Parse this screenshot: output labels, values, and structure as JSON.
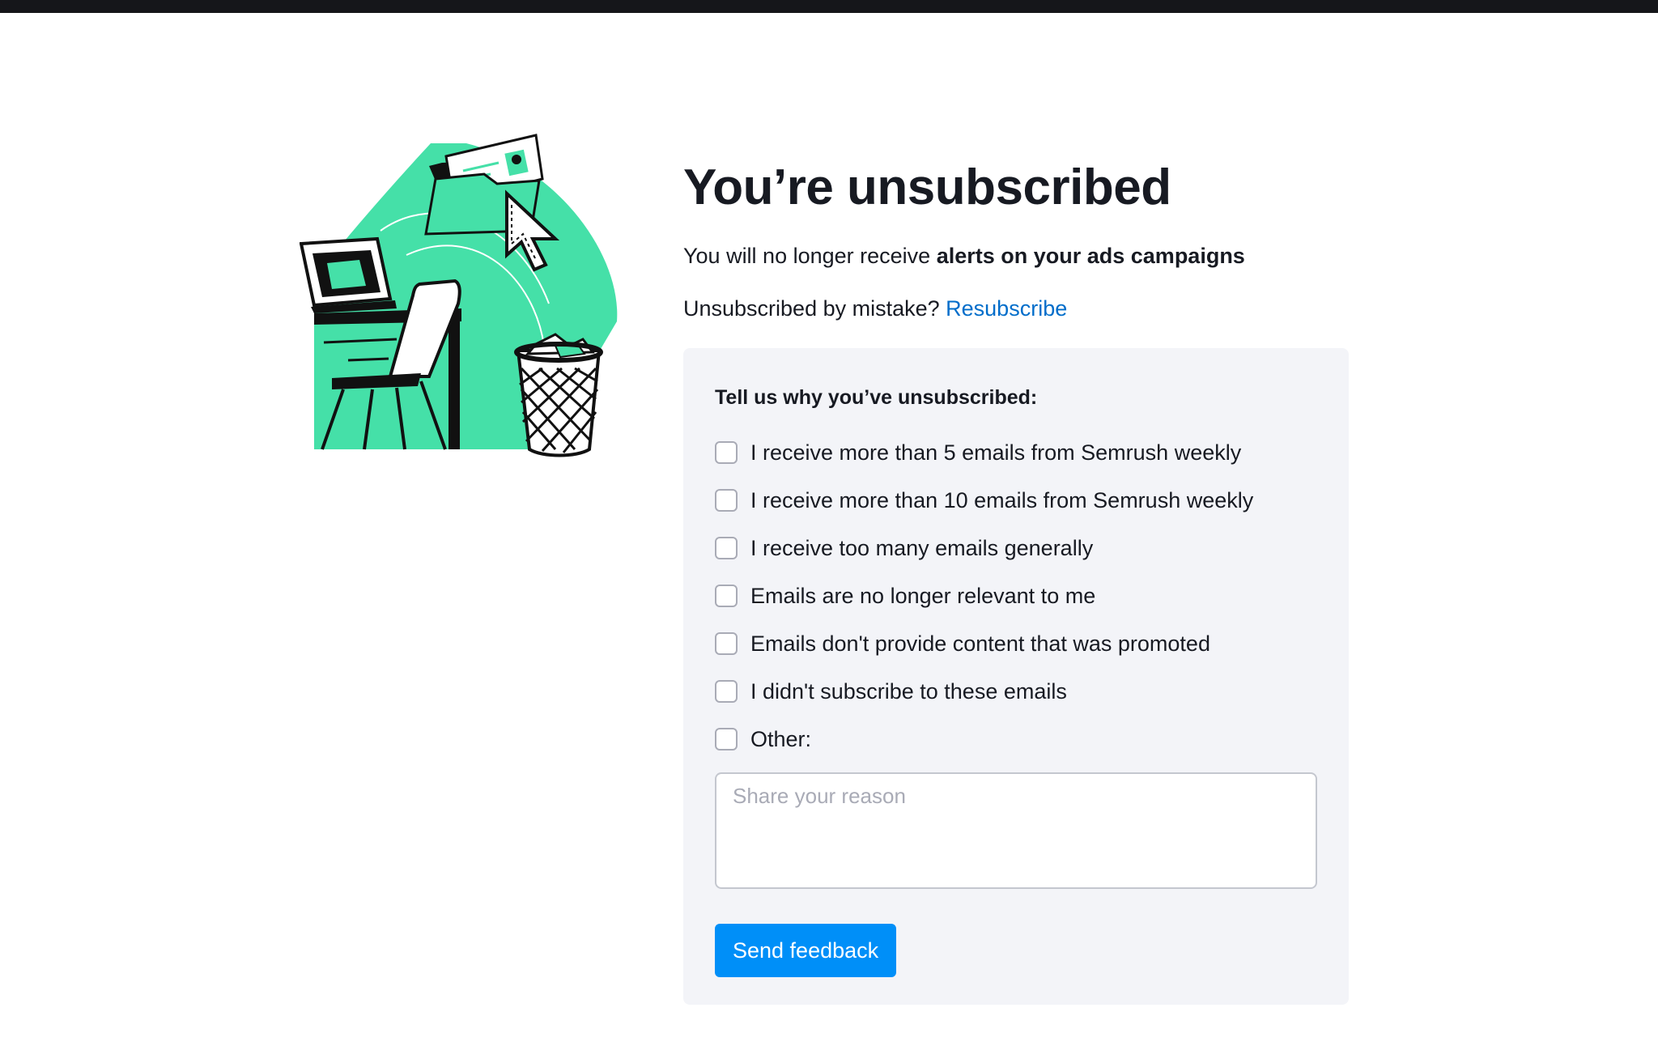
{
  "page": {
    "title": "You’re unsubscribed",
    "subtitle_prefix": "You will no longer receive ",
    "subtitle_bold": "alerts on your ads campaigns",
    "mistake_text": "Unsubscribed by mistake? ",
    "resubscribe_label": "Resubscribe"
  },
  "illustration": {
    "icon": "unsubscribe-illustration",
    "colors": {
      "accent": "#45e0a8",
      "outline": "#000000"
    }
  },
  "feedback": {
    "heading": "Tell us why you’ve unsubscribed:",
    "options": [
      {
        "label": "I receive more than 5 emails from Semrush weekly",
        "checked": false
      },
      {
        "label": "I receive more than 10 emails from Semrush weekly",
        "checked": false
      },
      {
        "label": "I receive too many emails generally",
        "checked": false
      },
      {
        "label": "Emails are no longer relevant to me",
        "checked": false
      },
      {
        "label": "Emails don't provide content that was promoted",
        "checked": false
      },
      {
        "label": "I didn't subscribe to these emails",
        "checked": false
      },
      {
        "label": "Other:",
        "checked": false
      }
    ],
    "reason_placeholder": "Share your reason",
    "reason_value": "",
    "send_label": "Send feedback"
  },
  "colors": {
    "link": "#006dca",
    "button": "#008ff8",
    "panel_bg": "#f3f4f8",
    "top_bar": "#15161a",
    "text": "#171a22"
  }
}
